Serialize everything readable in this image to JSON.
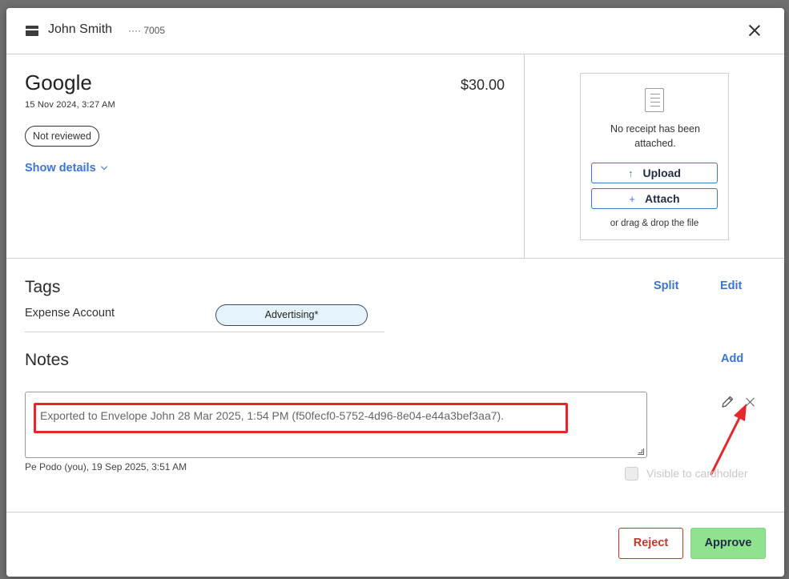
{
  "header": {
    "cardholder_name": "John Smith",
    "card_last4": "···· 7005",
    "card_icon": "credit-card-icon",
    "close_icon": "close-icon"
  },
  "transaction": {
    "merchant": "Google",
    "amount": "$30.00",
    "date": "15 Nov 2024, 3:27 AM",
    "status": "Not reviewed",
    "show_details_label": "Show details"
  },
  "receipt": {
    "message": "No receipt has been attached.",
    "upload_label": "Upload",
    "upload_icon": "↑",
    "attach_label": "Attach",
    "attach_icon": "+",
    "drag_note": "or drag & drop the file"
  },
  "tags": {
    "title": "Tags",
    "split_label": "Split",
    "edit_label": "Edit",
    "items": [
      {
        "label": "Expense Account",
        "value": "Advertising*"
      }
    ]
  },
  "notes": {
    "title": "Notes",
    "add_label": "Add",
    "items": [
      {
        "text": "Exported to Envelope John 28 Mar 2025, 1:54 PM (f50fecf0-5752-4d96-8e04-e44a3bef3aa7).",
        "meta": "Pe Podo (you), 19 Sep 2025, 3:51 AM",
        "visible_to_cardholder_label": "Visible to cardholder",
        "visible_to_cardholder": false
      }
    ]
  },
  "footer": {
    "reject_label": "Reject",
    "approve_label": "Approve"
  },
  "colors": {
    "accent": "#3b74d6",
    "reject": "#c0392b",
    "approve": "#8fe38f",
    "tag_bg": "#e4f3fc",
    "annotation": "#e5262a"
  }
}
